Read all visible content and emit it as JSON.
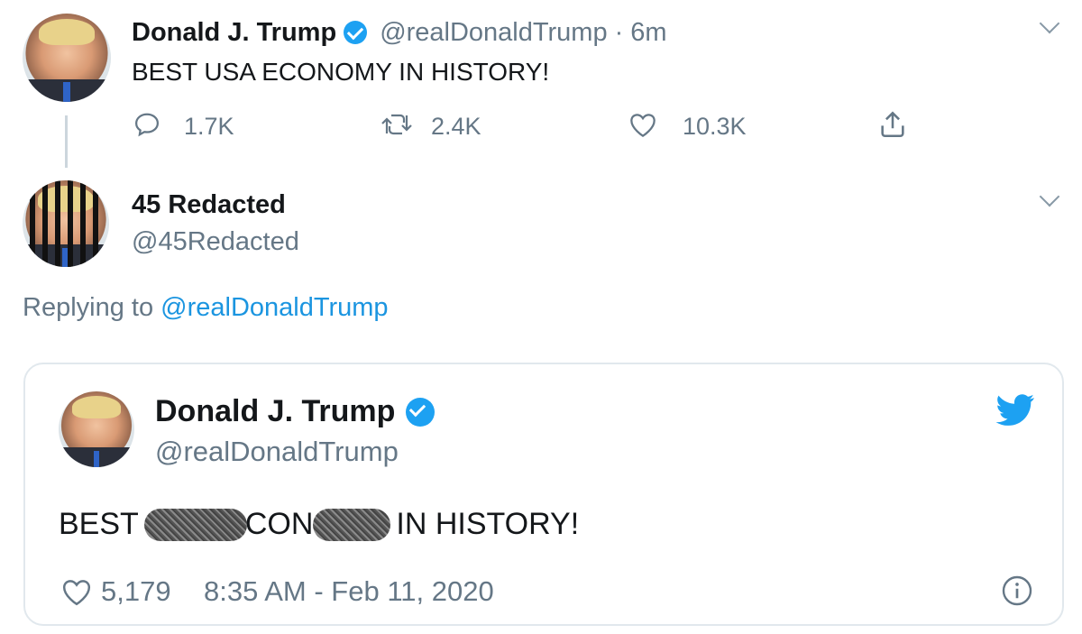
{
  "tweet": {
    "name": "Donald J. Trump",
    "handle": "@realDonaldTrump",
    "separator": "·",
    "time": "6m",
    "text": "BEST USA ECONOMY IN HISTORY!",
    "replies": "1.7K",
    "retweets": "2.4K",
    "likes": "10.3K"
  },
  "reply": {
    "name": "45 Redacted",
    "handle": "@45Redacted",
    "replying_prefix": "Replying to",
    "replying_to": "@realDonaldTrump"
  },
  "embed": {
    "name": "Donald J. Trump",
    "handle": "@realDonaldTrump",
    "text_part1": "BEST",
    "text_part2": "CON",
    "text_part3": "IN HISTORY!",
    "likes": "5,179",
    "timestamp": "8:35 AM - Feb 11, 2020"
  },
  "colors": {
    "link_blue": "#1b95e0",
    "verified_blue": "#1da1f2",
    "muted": "#657786",
    "border": "#e1e8ed"
  },
  "icons": [
    "reply-icon",
    "retweet-icon",
    "like-icon",
    "share-icon",
    "chevron-down-icon",
    "verified-icon",
    "twitter-bird-icon",
    "info-icon"
  ]
}
